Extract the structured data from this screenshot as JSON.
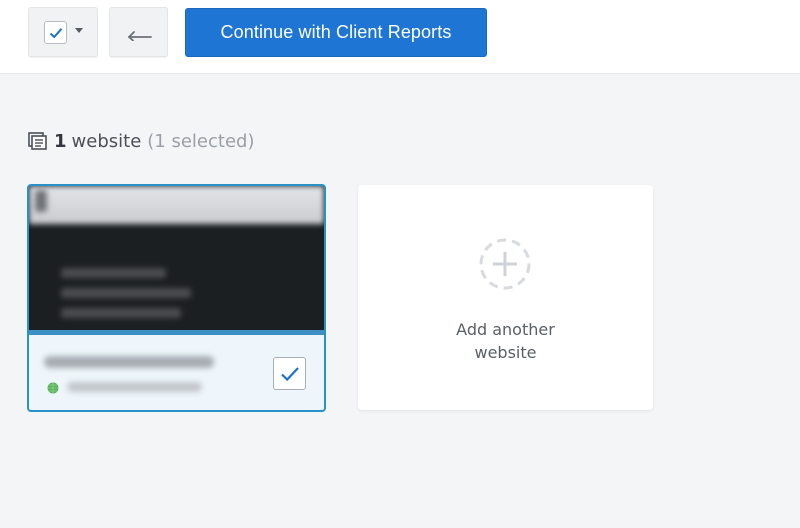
{
  "toolbar": {
    "select_menu_icon": "checkbox-dropdown-icon",
    "back_icon": "arrow-left-icon",
    "primary_label": "Continue with Client Reports"
  },
  "summary": {
    "count": "1",
    "noun": "website",
    "selected_text": "(1 selected)"
  },
  "sites": [
    {
      "checked": true,
      "status_icon": "globe-icon"
    }
  ],
  "add_card": {
    "line1": "Add another",
    "line2": "website"
  },
  "colors": {
    "primary": "#1e75d4",
    "selected_border": "#2a91c6",
    "check": "#1a73c9"
  }
}
